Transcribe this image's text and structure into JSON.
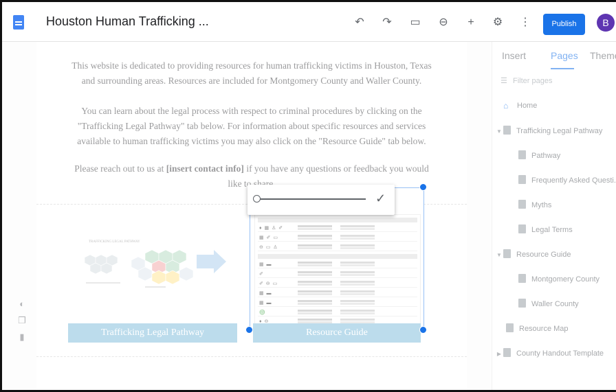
{
  "topbar": {
    "title": "Houston Human Trafficking ...",
    "publish_label": "Publish",
    "avatar_letter": "B",
    "icons": [
      "undo-icon",
      "redo-icon",
      "preview-icon",
      "link-icon",
      "share-icon",
      "settings-icon",
      "more-icon"
    ]
  },
  "page": {
    "para1": "This website is dedicated to providing resources for human trafficking victims in Houston, Texas and surrounding areas. Resources are included for Montgomery County and Waller County.",
    "para2": "You can learn about the legal process with respect to criminal procedures by clicking on the \"Trafficking Legal Pathway\" tab below. For information about specific resources and services available to human trafficking victims you may also click on the \"Resource Guide\" tab below.",
    "para3_a": "Please reach out to us at ",
    "para3_bold": "[insert contact info]",
    "para3_b": " if you have any questions or feedback you would like to share.",
    "btn_left": "Trafficking Legal Pathway",
    "btn_right": "Resource Guide",
    "diagram_title": "TRAFFICKING LEGAL PATHWAY"
  },
  "zoom": {
    "level": 0.0
  },
  "panel": {
    "tabs": [
      "Insert",
      "Pages",
      "Themes"
    ],
    "active_tab": "Pages",
    "filter_placeholder": "Filter pages",
    "pages": [
      {
        "label": "Home",
        "level": 0,
        "kind": "home"
      },
      {
        "label": "Trafficking Legal Pathway",
        "level": 0,
        "kind": "expandable"
      },
      {
        "label": "Pathway",
        "level": 1,
        "kind": "page"
      },
      {
        "label": "Frequently Asked Questi...",
        "level": 1,
        "kind": "page"
      },
      {
        "label": "Myths",
        "level": 1,
        "kind": "page"
      },
      {
        "label": "Legal Terms",
        "level": 1,
        "kind": "page"
      },
      {
        "label": "Resource Guide",
        "level": 0,
        "kind": "expandable"
      },
      {
        "label": "Montgomery County",
        "level": 1,
        "kind": "page"
      },
      {
        "label": "Waller County",
        "level": 1,
        "kind": "page"
      },
      {
        "label": "Resource Map",
        "level": 0,
        "kind": "page"
      },
      {
        "label": "County Handout Template",
        "level": 0,
        "kind": "collapsed"
      }
    ]
  },
  "colors": {
    "accent": "#1a73e8",
    "button_bg": "#6cb2d6"
  }
}
